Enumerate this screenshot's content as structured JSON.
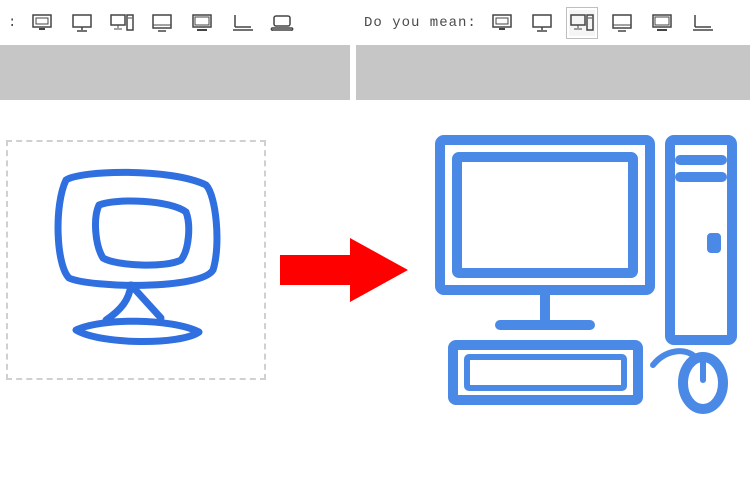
{
  "left_panel": {
    "prompt_tail": ":",
    "suggestions": [
      {
        "name": "monitor-crt-icon"
      },
      {
        "name": "monitor-flat-icon"
      },
      {
        "name": "desktop-tower-icon"
      },
      {
        "name": "monitor-outline-icon"
      },
      {
        "name": "monitor-classic-icon"
      },
      {
        "name": "laptop-half-icon"
      },
      {
        "name": "laptop-rounded-icon"
      }
    ]
  },
  "right_panel": {
    "prompt": "Do you mean:",
    "suggestions": [
      {
        "name": "monitor-crt-icon"
      },
      {
        "name": "monitor-flat-icon"
      },
      {
        "name": "desktop-tower-icon",
        "selected": true
      },
      {
        "name": "monitor-outline-icon"
      },
      {
        "name": "monitor-classic-icon"
      },
      {
        "name": "laptop-half-icon"
      }
    ]
  },
  "colors": {
    "sketch_stroke": "#2f6fe0",
    "result_stroke": "#4a8ae6",
    "arrow_fill": "#ff0000"
  }
}
